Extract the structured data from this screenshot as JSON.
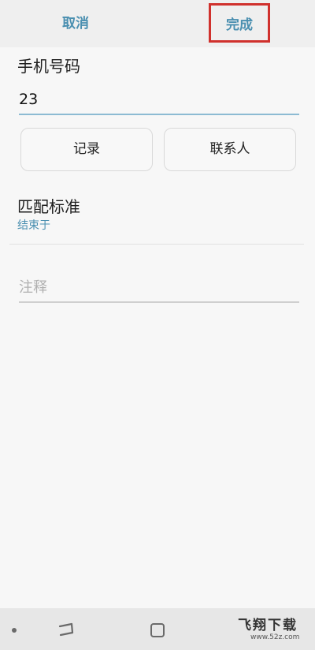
{
  "header": {
    "cancel_label": "取消",
    "done_label": "完成"
  },
  "phone": {
    "label": "手机号码",
    "value": "23"
  },
  "actions": {
    "records_label": "记录",
    "contacts_label": "联系人"
  },
  "match": {
    "title": "匹配标准",
    "value": "结束于"
  },
  "note": {
    "placeholder": "注释"
  },
  "watermark": {
    "brand": "飞翔下载",
    "url": "www.52z.com"
  },
  "colors": {
    "accent": "#4a8fb0",
    "highlight_box": "#d0312d"
  }
}
